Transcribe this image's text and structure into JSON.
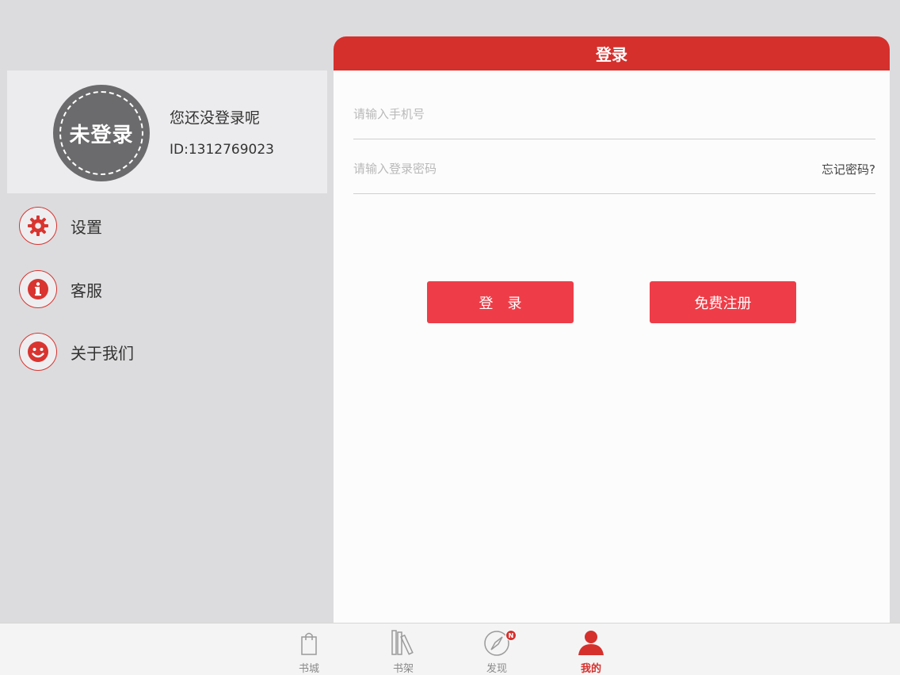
{
  "profile": {
    "avatar_text": "未登录",
    "status": "您还没登录呢",
    "id": "ID:1312769023"
  },
  "menu": {
    "items": [
      {
        "label": "设置",
        "icon": "gear-icon"
      },
      {
        "label": "客服",
        "icon": "info-icon"
      },
      {
        "label": "关于我们",
        "icon": "smiley-icon"
      }
    ]
  },
  "login": {
    "title": "登录",
    "phone_placeholder": "请输入手机号",
    "password_placeholder": "请输入登录密码",
    "forgot_label": "忘记密码?",
    "login_button": "登录",
    "register_button": "免费注册"
  },
  "tabbar": {
    "tabs": [
      {
        "label": "书城",
        "icon": "shopping-bag-icon"
      },
      {
        "label": "书架",
        "icon": "bookshelf-icon"
      },
      {
        "label": "发现",
        "icon": "compass-icon",
        "badge": "N"
      },
      {
        "label": "我的",
        "icon": "person-icon",
        "active": true
      }
    ]
  },
  "colors": {
    "accent": "#d5302c",
    "button": "#ee3d48",
    "background": "#dcdcde"
  }
}
